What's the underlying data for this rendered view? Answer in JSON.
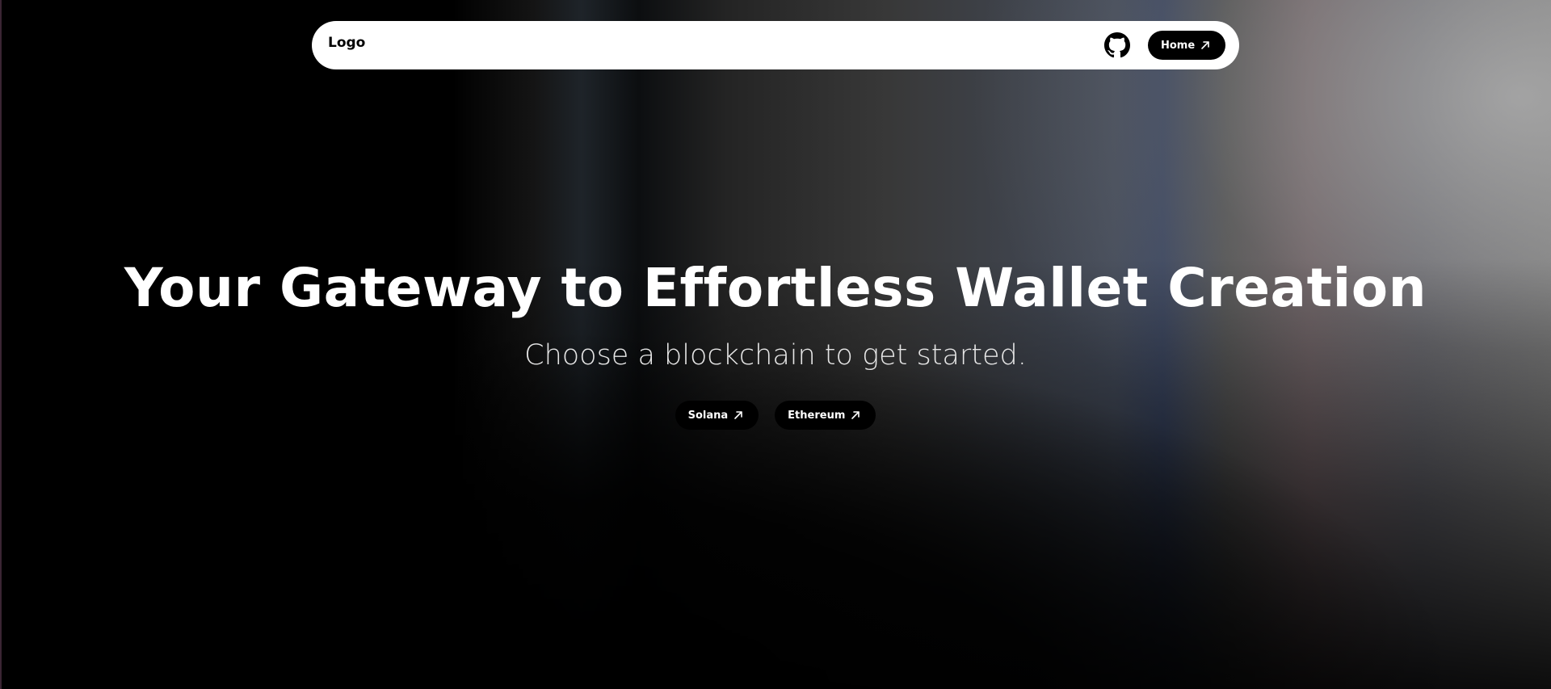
{
  "navbar": {
    "logo_text": "Logo",
    "github_icon": "github-icon",
    "home_label": "Home",
    "home_icon": "arrow-up-right-icon"
  },
  "hero": {
    "title": "Your Gateway to Effortless Wallet Creation",
    "subtitle": "Choose a blockchain to get started.",
    "buttons": [
      {
        "label": "Solana",
        "icon": "arrow-up-right-icon"
      },
      {
        "label": "Ethereum",
        "icon": "arrow-up-right-icon"
      }
    ]
  },
  "colors": {
    "background": "#000000",
    "navbar_bg": "#ffffff",
    "button_bg": "#000000",
    "button_text": "#ffffff",
    "title_text": "#ffffff"
  }
}
